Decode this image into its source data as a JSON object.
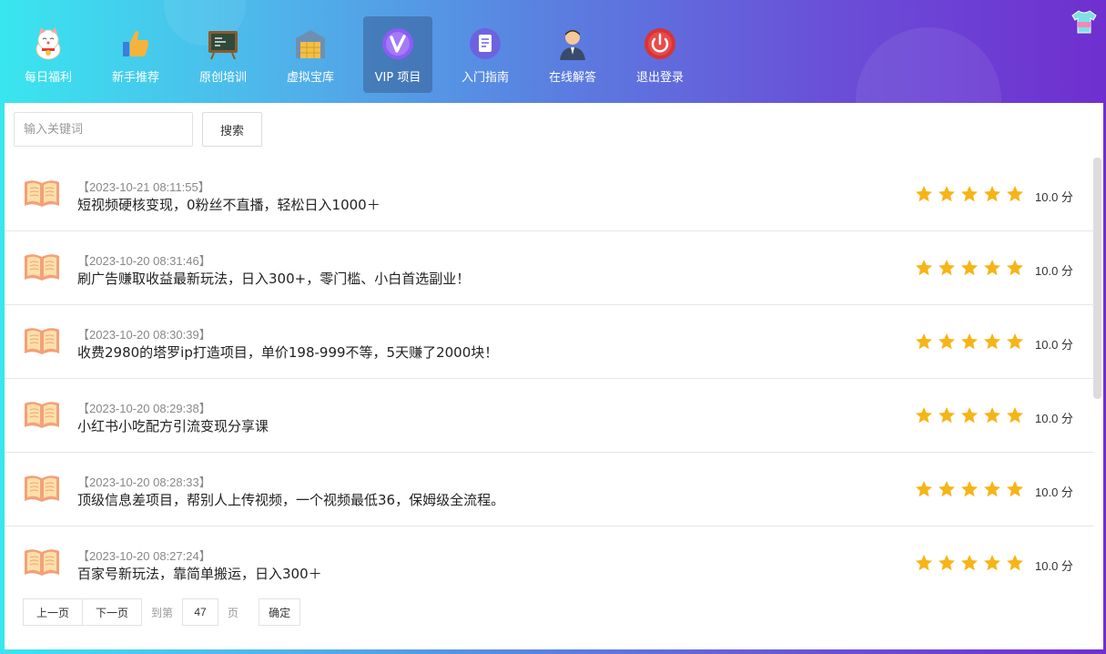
{
  "nav": {
    "items": [
      {
        "label": "每日福利",
        "icon": "lucky-cat-icon"
      },
      {
        "label": "新手推荐",
        "icon": "thumbs-up-icon"
      },
      {
        "label": "原创培训",
        "icon": "chalkboard-icon"
      },
      {
        "label": "虚拟宝库",
        "icon": "warehouse-icon"
      },
      {
        "label": "VIP 项目",
        "icon": "vip-badge-icon",
        "active": true
      },
      {
        "label": "入门指南",
        "icon": "document-icon"
      },
      {
        "label": "在线解答",
        "icon": "support-agent-icon"
      },
      {
        "label": "退出登录",
        "icon": "power-icon"
      }
    ]
  },
  "search": {
    "placeholder": "输入关键词",
    "button_label": "搜索"
  },
  "list": {
    "rating_max": 5,
    "items": [
      {
        "date": "【2023-10-21 08:11:55】",
        "title": "短视频硬核变现，0粉丝不直播，轻松日入1000＋",
        "rating": 5,
        "score": "10.0 分"
      },
      {
        "date": "【2023-10-20 08:31:46】",
        "title": "刷广告赚取收益最新玩法，日入300+，零门槛、小白首选副业！",
        "rating": 5,
        "score": "10.0 分"
      },
      {
        "date": "【2023-10-20 08:30:39】",
        "title": "收费2980的塔罗ip打造项目，单价198-999不等，5天赚了2000块！",
        "rating": 5,
        "score": "10.0 分"
      },
      {
        "date": "【2023-10-20 08:29:38】",
        "title": "小红书小吃配方引流变现分享课",
        "rating": 5,
        "score": "10.0 分"
      },
      {
        "date": "【2023-10-20 08:28:33】",
        "title": "顶级信息差项目，帮别人上传视频，一个视频最低36，保姆级全流程。",
        "rating": 5,
        "score": "10.0 分"
      },
      {
        "date": "【2023-10-20 08:27:24】",
        "title": "百家号新玩法，靠简单搬运，日入300＋",
        "rating": 5,
        "score": "10.0 分"
      }
    ]
  },
  "pager": {
    "prev_label": "上一页",
    "next_label": "下一页",
    "goto_label": "到第",
    "page_value": "47",
    "page_unit": "页",
    "confirm_label": "确定"
  },
  "colors": {
    "star": "#f6b416",
    "active_nav_bg": "#3a5f90"
  }
}
